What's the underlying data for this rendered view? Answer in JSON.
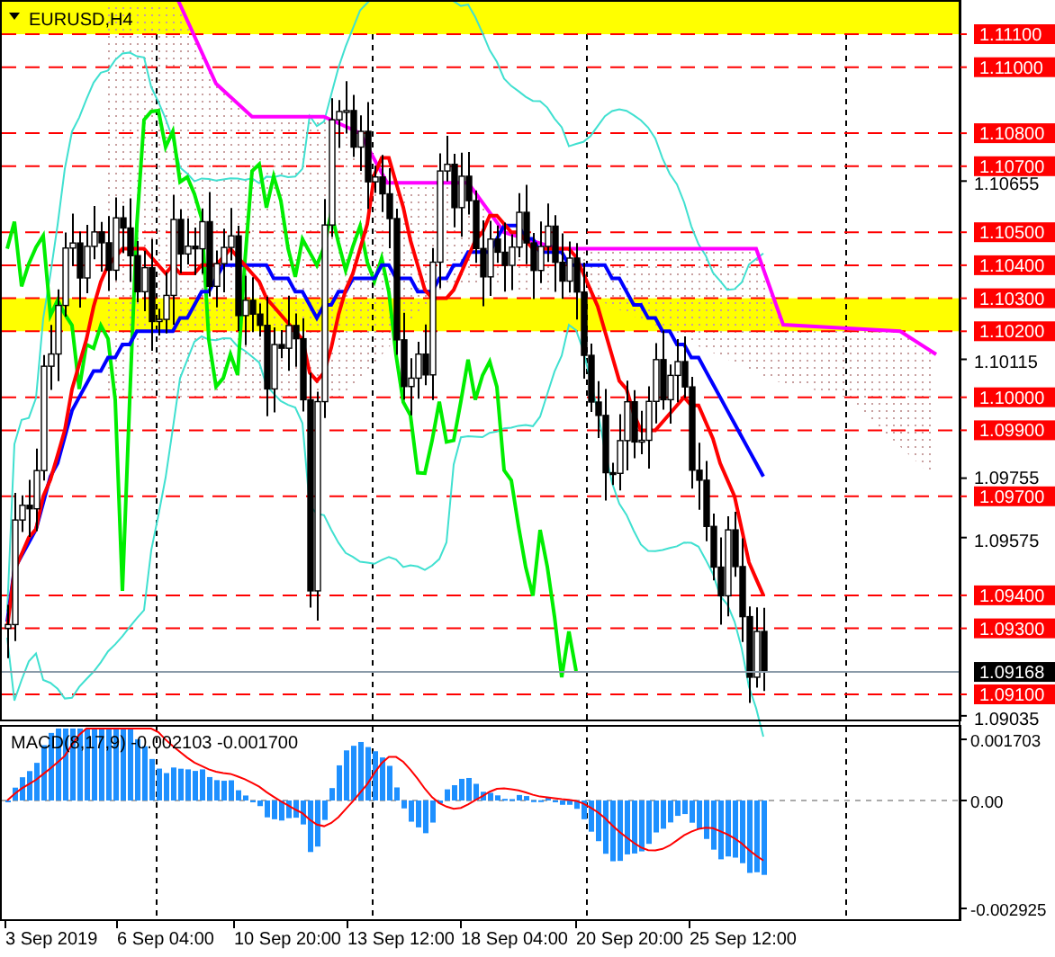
{
  "chart": {
    "title": "EURUSD,H4"
  },
  "price_levels": [
    {
      "label": "1.11100"
    },
    {
      "label": "1.11000"
    },
    {
      "label": "1.10800"
    },
    {
      "label": "1.10700"
    },
    {
      "label": "1.10500"
    },
    {
      "label": "1.10400"
    },
    {
      "label": "1.10300"
    },
    {
      "label": "1.10200"
    },
    {
      "label": "1.10000"
    },
    {
      "label": "1.09900"
    },
    {
      "label": "1.09700"
    },
    {
      "label": "1.09400"
    },
    {
      "label": "1.09300"
    },
    {
      "label": "1.09100"
    }
  ],
  "price_ticks": [
    "1.10655",
    "1.10115",
    "1.09755",
    "1.09575",
    "1.09035"
  ],
  "current_price": "1.09168",
  "macd": {
    "title": "MACD(8,17,9) -0.002103 -0.001700",
    "ticks": [
      "0.001703",
      "0.00",
      "-0.002925"
    ]
  },
  "time_labels": [
    "3 Sep 2019",
    "6 Sep 04:00",
    "10 Sep 20:00",
    "13 Sep 12:00",
    "18 Sep 04:00",
    "20 Sep 20:00",
    "25 Sep 12:00"
  ]
}
